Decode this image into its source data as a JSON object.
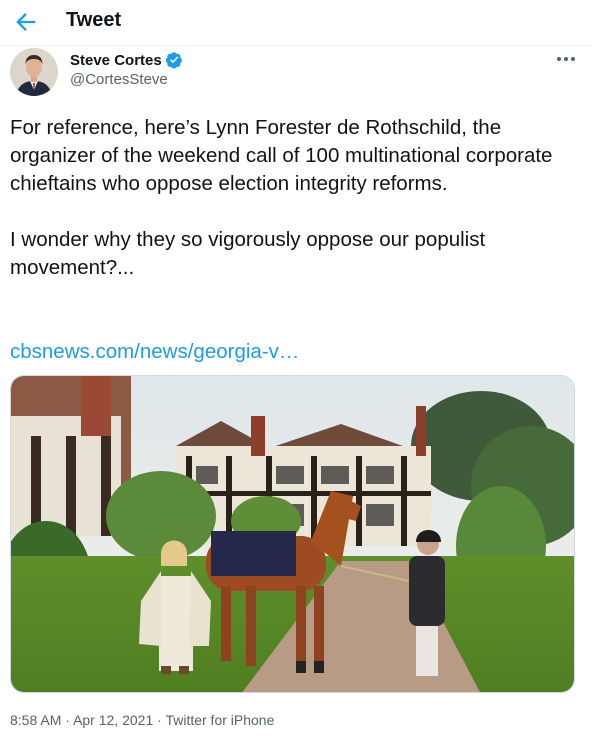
{
  "header": {
    "back_icon": "arrow-left-icon",
    "title": "Tweet"
  },
  "author": {
    "display_name": "Steve Cortes",
    "handle": "@CortesSteve",
    "verified_icon": "verified-badge-icon",
    "more_icon": "more-horizontal-icon"
  },
  "tweet": {
    "paragraphs": [
      "For reference, here’s Lynn Forester de Rothschild, the organizer of the weekend call of 100 multinational corporate chieftains who oppose election integrity reforms.",
      "I wonder why they so vigorously oppose our populist movement?..."
    ],
    "link": "cbsnews.com/news/georgia-v…"
  },
  "meta": {
    "time": "8:58 AM",
    "separator": "·",
    "date": "Apr 12, 2021",
    "source": "Twitter for iPhone"
  },
  "colors": {
    "accent": "#1d9bf0",
    "text": "#0f1419",
    "secondary": "#536471"
  }
}
